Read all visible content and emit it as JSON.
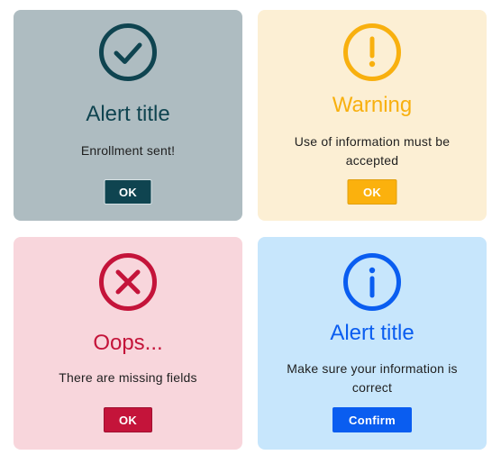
{
  "alerts": {
    "success": {
      "icon": "check-circle-icon",
      "title": "Alert title",
      "message": "Enrollment sent!",
      "button_label": "OK",
      "color": "#0f4450"
    },
    "warning": {
      "icon": "exclamation-circle-icon",
      "title": "Warning",
      "message": "Use of information must be accepted",
      "button_label": "OK",
      "color": "#f8b00f"
    },
    "error": {
      "icon": "x-circle-icon",
      "title": "Oops...",
      "message": "There are missing fields",
      "button_label": "OK",
      "color": "#c4143a"
    },
    "info": {
      "icon": "info-circle-icon",
      "title": "Alert title",
      "message": "Make sure your information is correct",
      "button_label": "Confirm",
      "color": "#0a5df0"
    }
  }
}
